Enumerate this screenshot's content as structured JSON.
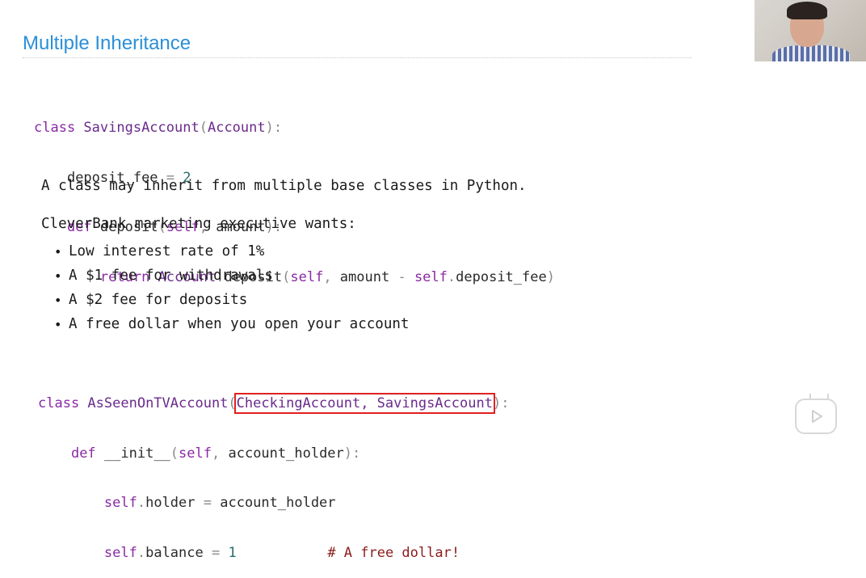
{
  "slide": {
    "title": "Multiple Inheritance"
  },
  "code1": {
    "l1_kw": "class ",
    "l1_cls": "SavingsAccount",
    "l1_paren_open": "(",
    "l1_base": "Account",
    "l1_paren_close": "):",
    "l2_indent": "    ",
    "l2_name": "deposit_fee",
    "l2_eq": " = ",
    "l2_num": "2",
    "l3_indent": "    ",
    "l3_kw": "def ",
    "l3_name": "deposit",
    "l3_open": "(",
    "l3_self": "self",
    "l3_comma": ", ",
    "l3_arg": "amount",
    "l3_close": "):",
    "l4_indent": "        ",
    "l4_kw": "return ",
    "l4_cls": "Account",
    "l4_dot": ".",
    "l4_method": "deposit",
    "l4_open": "(",
    "l4_self": "self",
    "l4_comma": ", ",
    "l4_amount": "amount",
    "l4_minus": " - ",
    "l4_self2": "self",
    "l4_dot2": ".",
    "l4_fee": "deposit_fee",
    "l4_close": ")"
  },
  "prose": {
    "statement": "A class may inherit from multiple base classes in Python.",
    "wants": "CleverBank marketing executive wants:",
    "bullets": [
      "Low interest rate of 1%",
      "A $1 fee for withdrawals",
      "A $2 fee for deposits",
      "A free dollar when you open your account"
    ]
  },
  "code2": {
    "l1_kw": "class ",
    "l1_cls": "AsSeenOnTVAccount",
    "l1_open": "(",
    "l1_bases": "CheckingAccount, SavingsAccount",
    "l1_close": "):",
    "l2_indent": "    ",
    "l2_kw": "def ",
    "l2_name": "__init__",
    "l2_open": "(",
    "l2_self": "self",
    "l2_comma": ", ",
    "l2_arg": "account_holder",
    "l2_close": "):",
    "l3_indent": "        ",
    "l3_self": "self",
    "l3_dot": ".",
    "l3_attr": "holder",
    "l3_eq": " = ",
    "l3_val": "account_holder",
    "l4_indent": "        ",
    "l4_self": "self",
    "l4_dot": ".",
    "l4_attr": "balance",
    "l4_eq": " = ",
    "l4_num": "1",
    "l4_pad": "           ",
    "l4_comment": "# A free dollar!"
  },
  "colors": {
    "title": "#2b8fd8",
    "keyword": "#8a2aa3",
    "comment": "#8b1c1c",
    "highlight_box": "#e02020"
  },
  "icons": {
    "webcam": "presenter-video",
    "player": "play-icon"
  }
}
